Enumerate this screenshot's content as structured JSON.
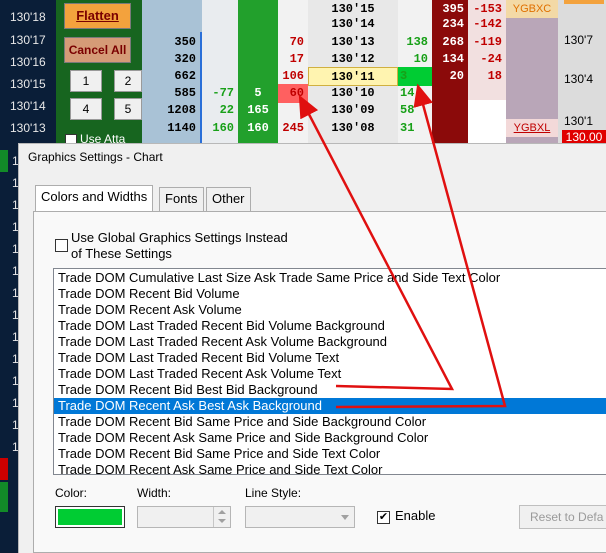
{
  "colors": {
    "app_bg": "#0b1d35",
    "panel_green": "#17651f",
    "flatten_bg": "#f3a23d",
    "cancel_bg": "#d59b77",
    "price_highlight_yellow": "#fff4b0",
    "bid_green_text": "#18a018",
    "ask_red_text": "#c00000",
    "ask_dark_red_bg": "#8b0a0a",
    "selected_row_blue": "#0078d7",
    "selected_color_swatch": "#00cc33",
    "annotation_arrow_red": "#e01010",
    "ybg_orange": "#e07000"
  },
  "price_scale": {
    "labels": [
      "130'18",
      "130'17",
      "130'16",
      "130'15",
      "130'14",
      "130'13",
      "1",
      "1",
      "1",
      "1",
      "1",
      "1",
      "1",
      "1",
      "1",
      "1",
      "1",
      "1",
      "1",
      "1"
    ]
  },
  "controls": {
    "flatten_label": "Flatten",
    "cancel_all_label": "Cancel All",
    "qty_buttons": [
      "1",
      "2",
      "4",
      "5"
    ],
    "use_attached_partial": "Use Atta"
  },
  "dom": {
    "rows": [
      {
        "price": "130'15",
        "ask": "395",
        "ask_chg": "-153"
      },
      {
        "price": "130'14",
        "ask": "234",
        "ask_chg": "-142"
      },
      {
        "bidsz": "350",
        "recent_ask": "70",
        "price": "130'13",
        "last_ask": "138",
        "ask": "268",
        "ask_chg": "-119"
      },
      {
        "bidsz": "320",
        "recent_ask": "17",
        "price": "130'12",
        "last_ask": "10",
        "ask": "134",
        "ask_chg": "-24"
      },
      {
        "bidsz": "662",
        "recent_ask": "106",
        "price": "130'11",
        "last_ask": "3",
        "ask": "20",
        "ask_chg": "18"
      },
      {
        "bidsz": "585",
        "bid_chg": "-77",
        "recent_bid": "5",
        "recent_ask": "60",
        "price": "130'10",
        "last_ask": "14"
      },
      {
        "bidsz": "1208",
        "bid_chg": "22",
        "recent_bid": "165",
        "price": "130'09",
        "last_ask": "58"
      },
      {
        "bidsz": "1140",
        "bid_chg": "160",
        "recent_bid": "160",
        "recent_ask": "245",
        "price": "130'08",
        "last_ask": "31"
      }
    ],
    "right_labels": {
      "ybgxc": "YGBXC",
      "ybgxl": "YGBXL",
      "axis_ticks": [
        "130'7",
        "130'4",
        "130'1"
      ],
      "price_badge": "130.00"
    }
  },
  "dialog": {
    "title": "Graphics Settings  - Chart",
    "tabs": [
      "Colors and Widths",
      "Fonts",
      "Other"
    ],
    "global_settings_line1": "Use Global Graphics Settings Instead",
    "global_settings_line2": "of These Settings",
    "list_items": [
      "Trade DOM Cumulative Last Size Ask Trade Same Price and Side Text Color",
      "Trade DOM Recent Bid Volume",
      "Trade DOM Recent Ask Volume",
      "Trade DOM Last Traded Recent Bid Volume Background",
      "Trade DOM Last Traded Recent Ask Volume Background",
      "Trade DOM Last Traded Recent Bid Volume Text",
      "Trade DOM Last Traded Recent Ask Volume Text",
      "Trade DOM Recent Bid Best Bid Background",
      "Trade DOM Recent Ask Best Ask Background",
      "Trade DOM Recent Bid Same Price and Side Background Color",
      "Trade DOM Recent Ask Same Price and Side Background Color",
      "Trade DOM Recent Bid Same Price and Side Text Color",
      "Trade DOM Recent Ask Same Price and Side Text Color"
    ],
    "selected_index": 8,
    "color_label": "Color:",
    "width_label": "Width:",
    "line_style_label": "Line Style:",
    "enable_label": "Enable",
    "enable_checked": true,
    "reset_label": "Reset to Defa"
  }
}
